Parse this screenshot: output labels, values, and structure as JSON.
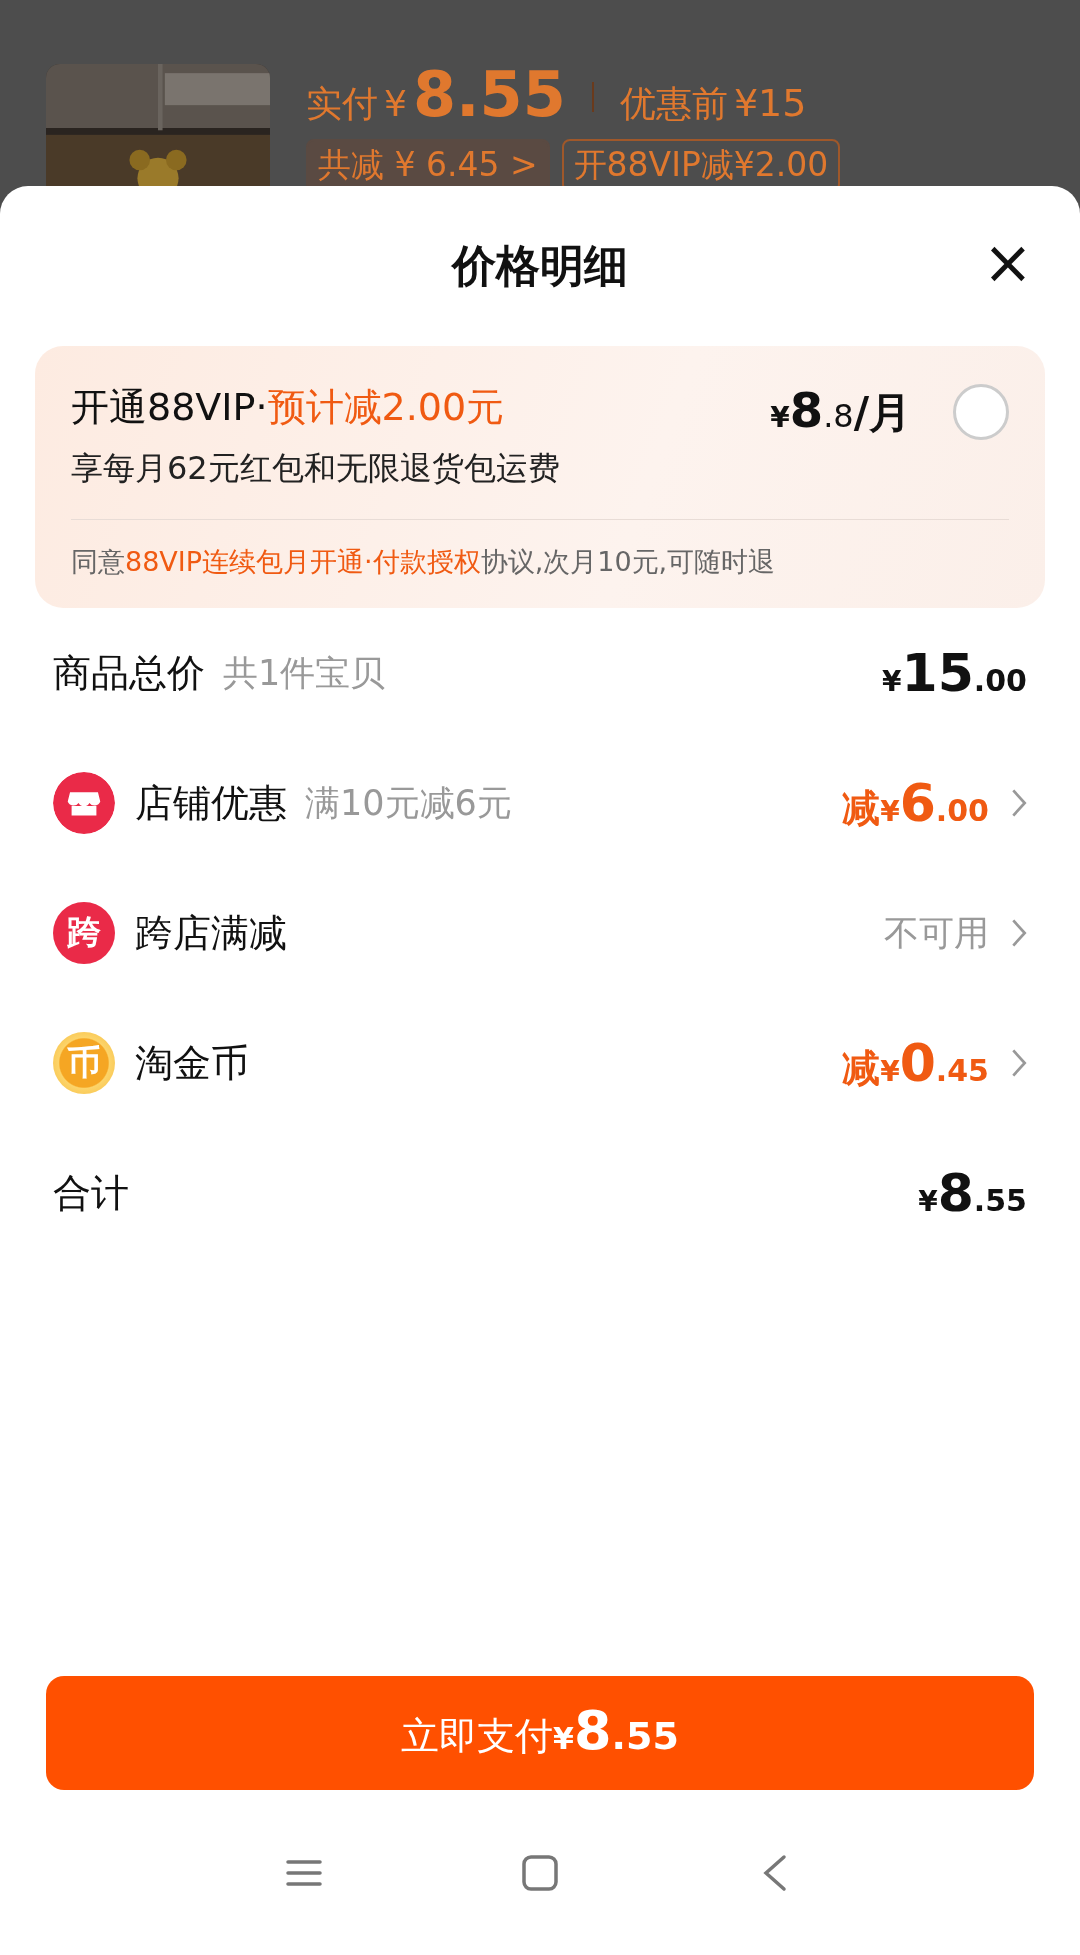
{
  "background": {
    "paid_label": "实付",
    "paid_currency": "¥",
    "paid_amount": "8.55",
    "original_label": "优惠前",
    "original_price": "¥15",
    "tags": [
      "共减 ¥ 6.45 >",
      "开88VIP减¥2.00"
    ]
  },
  "sheet": {
    "title": "价格明细",
    "close": "×"
  },
  "vip": {
    "title": "开通88VIP·",
    "discount": "预计减2.00元",
    "price": {
      "currency": "¥",
      "integer": "8",
      "decimal": ".8",
      "suffix": "/月"
    },
    "selected": false,
    "benefit": "享每月62元红包和无限退货包运费",
    "agree_prefix": "同意",
    "agree_link": "88VIP连续包月开通·付款授权",
    "agree_suffix": "协议,次月10元,可随时退"
  },
  "rows": [
    {
      "kind": "plain",
      "label": "商品总价",
      "note": "共1件宝贝",
      "value": {
        "kind": "price",
        "currency": "¥",
        "integer": "15",
        "decimal": ".00"
      },
      "arrow": false
    },
    {
      "kind": "shop",
      "label": "店铺优惠",
      "note": "满10元减6元",
      "value": {
        "kind": "discount",
        "prefix": "减",
        "currency": "¥",
        "integer": "6",
        "decimal": ".00"
      },
      "arrow": true
    },
    {
      "kind": "badge",
      "icon_text": "跨",
      "label": "跨店满减",
      "value": {
        "kind": "text",
        "text": "不可用"
      },
      "arrow": true
    },
    {
      "kind": "coin",
      "icon_text": "币",
      "label": "淘金币",
      "value": {
        "kind": "discount",
        "prefix": "减",
        "currency": "¥",
        "integer": "0",
        "decimal": ".45"
      },
      "arrow": true
    },
    {
      "kind": "plain",
      "label": "合计",
      "value": {
        "kind": "price",
        "currency": "¥",
        "integer": "8",
        "decimal": ".55"
      },
      "arrow": false
    }
  ],
  "pay_button": {
    "label": "立即支付",
    "currency": "¥",
    "integer": "8",
    "decimal": ".55"
  }
}
